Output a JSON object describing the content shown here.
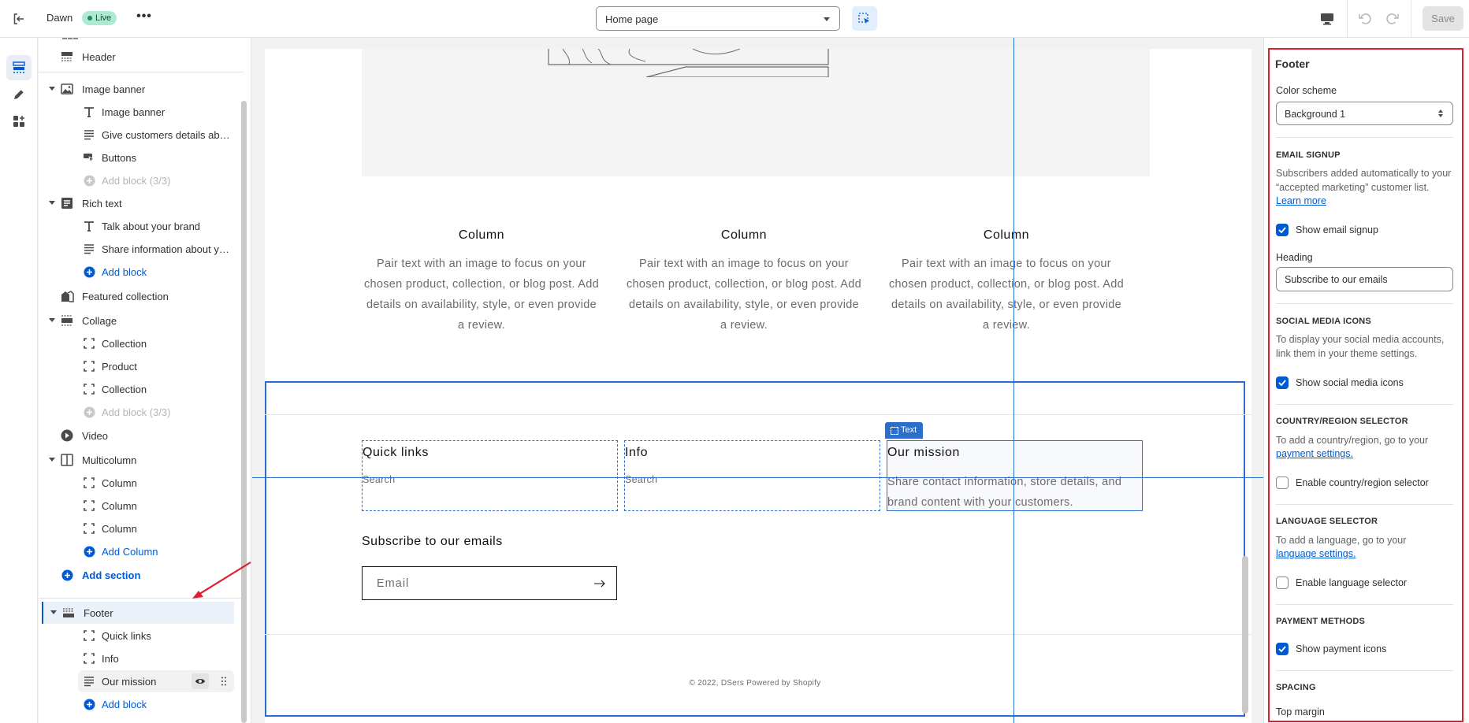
{
  "topbar": {
    "theme_name": "Dawn",
    "status_badge": "Live",
    "more_label": "•••",
    "page_select_value": "Home page",
    "save_label": "Save"
  },
  "sidebar": {
    "items": [
      {
        "type": "section",
        "label": "Header",
        "icon": "header-icon"
      },
      {
        "type": "section",
        "label": "Image banner",
        "icon": "image-icon",
        "expanded": true
      },
      {
        "type": "block",
        "label": "Image banner",
        "icon": "text-icon"
      },
      {
        "type": "block",
        "label": "Give customers details about the banner image(s) or content on the template.",
        "icon": "paragraph-icon"
      },
      {
        "type": "block",
        "label": "Buttons",
        "icon": "button-icon"
      },
      {
        "type": "add-muted",
        "label": "Add block (3/3)",
        "icon": "add-circle-icon"
      },
      {
        "type": "section",
        "label": "Rich text",
        "icon": "rich-text-icon",
        "expanded": true
      },
      {
        "type": "block",
        "label": "Talk about your brand",
        "icon": "text-icon"
      },
      {
        "type": "block",
        "label": "Share information about your brand with your customers.",
        "icon": "paragraph-icon"
      },
      {
        "type": "add",
        "label": "Add block",
        "icon": "add-circle-icon"
      },
      {
        "type": "section",
        "label": "Featured collection",
        "icon": "collection-icon"
      },
      {
        "type": "section",
        "label": "Collage",
        "icon": "layout-icon",
        "expanded": true
      },
      {
        "type": "block",
        "label": "Collection",
        "icon": "block-frame-icon"
      },
      {
        "type": "block",
        "label": "Product",
        "icon": "block-frame-icon"
      },
      {
        "type": "block",
        "label": "Collection",
        "icon": "block-frame-icon"
      },
      {
        "type": "add-muted",
        "label": "Add block (3/3)",
        "icon": "add-circle-icon"
      },
      {
        "type": "section",
        "label": "Video",
        "icon": "play-icon"
      },
      {
        "type": "section",
        "label": "Multicolumn",
        "icon": "columns-icon",
        "expanded": true
      },
      {
        "type": "block",
        "label": "Column",
        "icon": "block-frame-icon"
      },
      {
        "type": "block",
        "label": "Column",
        "icon": "block-frame-icon"
      },
      {
        "type": "block",
        "label": "Column",
        "icon": "block-frame-icon"
      },
      {
        "type": "add",
        "label": "Add Column",
        "icon": "add-circle-icon"
      },
      {
        "type": "add-section",
        "label": "Add section",
        "icon": "add-circle-icon"
      },
      {
        "type": "section",
        "label": "Footer",
        "icon": "footer-icon",
        "expanded": true,
        "selected": true
      },
      {
        "type": "block",
        "label": "Quick links",
        "icon": "block-frame-icon"
      },
      {
        "type": "block",
        "label": "Info",
        "icon": "block-frame-icon"
      },
      {
        "type": "block",
        "label": "Our mission",
        "icon": "paragraph-icon",
        "hover": true
      },
      {
        "type": "add",
        "label": "Add block",
        "icon": "add-circle-icon"
      }
    ]
  },
  "preview": {
    "columns": [
      {
        "title": "Column",
        "text": "Pair text with an image to focus on your chosen product, collection, or blog post. Add details on availability, style, or even provide a review."
      },
      {
        "title": "Column",
        "text": "Pair text with an image to focus on your chosen product, collection, or blog post. Add details on availability, style, or even provide a review."
      },
      {
        "title": "Column",
        "text": "Pair text with an image to focus on your chosen product, collection, or blog post. Add details on availability, style, or even provide a review."
      }
    ],
    "footer": {
      "blocks": [
        {
          "title": "Quick links",
          "link": "Search"
        },
        {
          "title": "Info",
          "link": "Search"
        },
        {
          "title": "Our mission",
          "text": "Share contact information, store details, and brand content with your customers."
        }
      ],
      "block_tag": "Text",
      "subscribe_title": "Subscribe to our emails",
      "email_placeholder": "Email",
      "copyright": "© 2022, DSers Powered by Shopify"
    }
  },
  "settings": {
    "title": "Footer",
    "color_scheme_label": "Color scheme",
    "color_scheme_value": "Background 1",
    "email_signup": {
      "heading": "EMAIL SIGNUP",
      "help": "Subscribers added automatically to your “accepted marketing” customer list.",
      "learn_more": "Learn more",
      "show_label": "Show email signup",
      "show_checked": true,
      "heading_label": "Heading",
      "heading_value": "Subscribe to our emails"
    },
    "social": {
      "heading": "SOCIAL MEDIA ICONS",
      "help": "To display your social media accounts, link them in your theme settings.",
      "show_label": "Show social media icons",
      "show_checked": true
    },
    "country": {
      "heading": "COUNTRY/REGION SELECTOR",
      "help": "To add a country/region, go to your",
      "link": "payment settings.",
      "enable_label": "Enable country/region selector",
      "enable_checked": false
    },
    "language": {
      "heading": "LANGUAGE SELECTOR",
      "help": "To add a language, go to your",
      "link": "language settings.",
      "enable_label": "Enable language selector",
      "enable_checked": false
    },
    "payment": {
      "heading": "PAYMENT METHODS",
      "show_label": "Show payment icons",
      "show_checked": true
    },
    "spacing": {
      "heading": "SPACING",
      "top_margin_label": "Top margin"
    }
  },
  "colors": {
    "accent": "#005bd3",
    "selection": "#2c6ecb",
    "annotation": "#e01e2f",
    "live_badge": "#aee9d1"
  }
}
